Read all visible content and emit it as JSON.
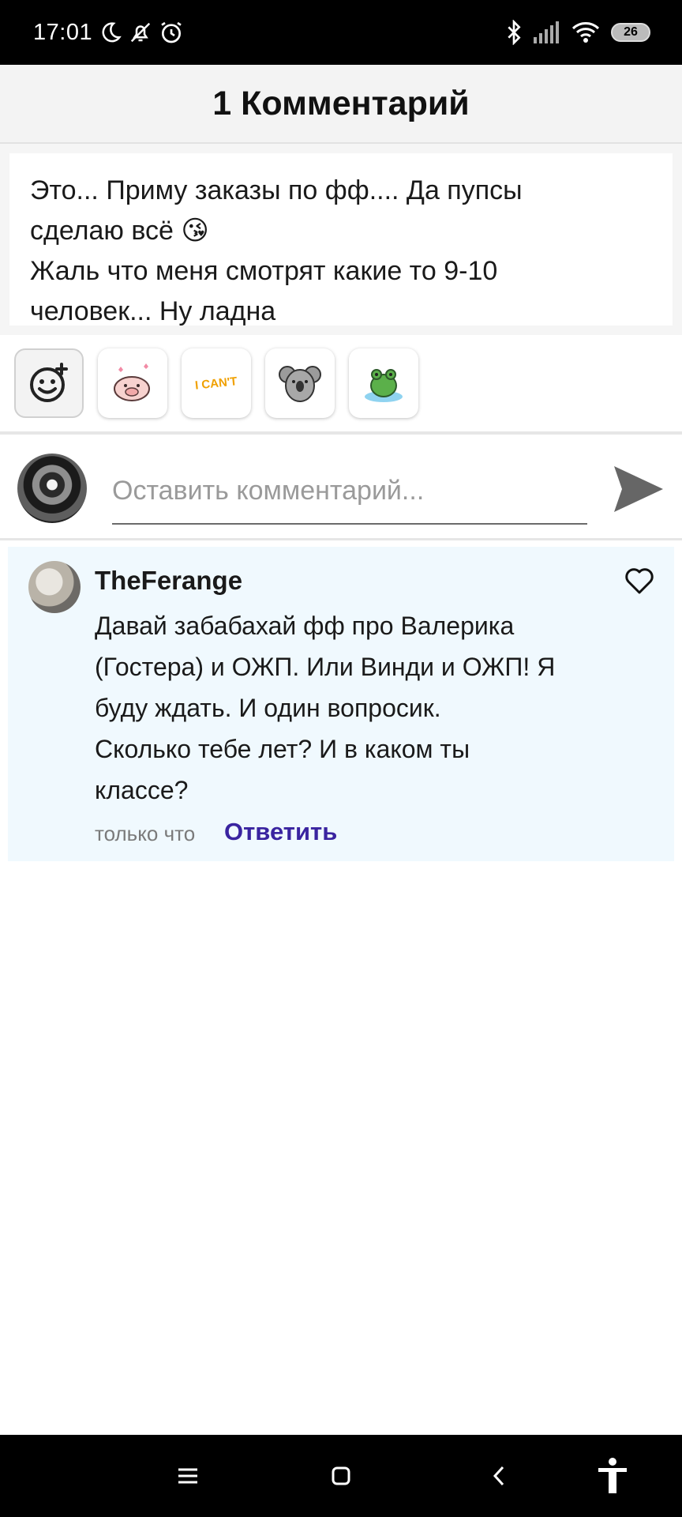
{
  "status_bar": {
    "time": "17:01",
    "battery": "26",
    "icons_left": [
      "moon-icon",
      "bell-off-icon",
      "alarm-icon"
    ],
    "icons_right": [
      "bluetooth-icon",
      "signal-icon",
      "wifi-icon",
      "battery-icon"
    ]
  },
  "header": {
    "title": "1 Комментарий"
  },
  "story": {
    "line1": "Это... Приму заказы по фф.... Да пупсы",
    "line2": "сделаю всё 😘",
    "line3": "Жаль что меня смотрят какие то 9-10",
    "line4": "человек... Ну ладна"
  },
  "stickers": {
    "items": [
      "add-sticker-icon",
      "pig-sticker",
      "i-cant-sticker",
      "koala-sticker",
      "frog-sticker"
    ],
    "i_cant_text": "I CAN'T"
  },
  "comment_input": {
    "placeholder": "Оставить комментарий..."
  },
  "comment": {
    "author": "TheFerange",
    "text_line1": "Давай забабахай фф про Валерика",
    "text_line2": "(Гостера) и ОЖП. Или Винди и ОЖП! Я",
    "text_line3": "буду ждать. И один вопросик.",
    "text_line4": "Сколько тебе лет? И в каком ты",
    "text_line5": "классе?",
    "time": "только что",
    "reply_label": "Ответить"
  },
  "colors": {
    "accent": "#3a24a0",
    "comment_bg": "#f0f9fe",
    "header_bg": "#f3f3f3"
  }
}
